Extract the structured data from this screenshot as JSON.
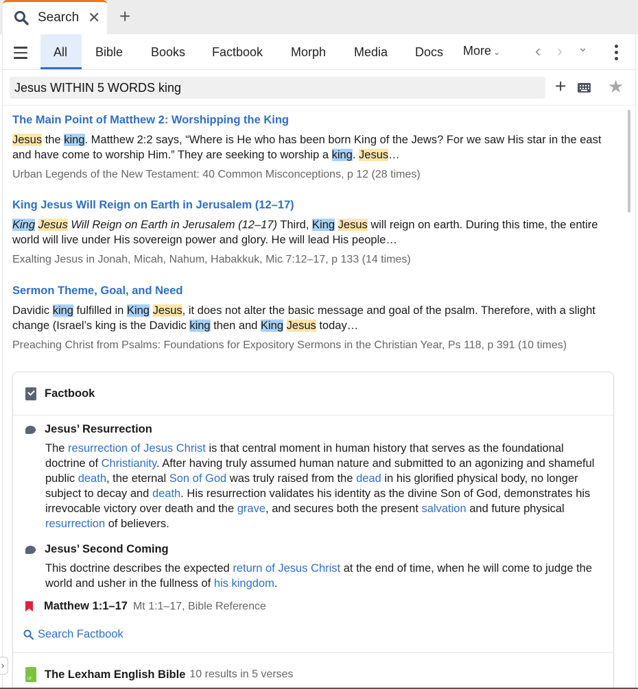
{
  "tab": {
    "title": "Search",
    "close": "✕",
    "new_tab": "+"
  },
  "categories": {
    "all": "All",
    "items": [
      "Bible",
      "Books",
      "Factbook",
      "Morph",
      "Media",
      "Docs"
    ],
    "more": "More",
    "more_chevron": "⌄"
  },
  "nav": {
    "back": "‹",
    "forward": "›",
    "dropdown": "⌄"
  },
  "search": {
    "query": "Jesus WITHIN 5 WORDS king",
    "add": "+",
    "star": "★"
  },
  "results": [
    {
      "title": "The Main Point of Matthew 2: Worshipping the King",
      "snippet": [
        {
          "t": "Jesus",
          "h": "j"
        },
        {
          "t": " the "
        },
        {
          "t": "king",
          "h": "k"
        },
        {
          "t": ". Matthew 2:2 says, “Where is He who has been born King of the Jews? For we saw His star in the east and have come to worship Him.” They are seeking to worship a "
        },
        {
          "t": "king",
          "h": "k"
        },
        {
          "t": ". "
        },
        {
          "t": "Jesus",
          "h": "j"
        },
        {
          "t": "…"
        }
      ],
      "source": "Urban Legends of the New Testament: 40 Common Misconceptions, p 12 (28 times)"
    },
    {
      "title": "King Jesus Will Reign on Earth in Jerusalem (12–17)",
      "snippet": [
        {
          "t": "King",
          "h": "k",
          "i": true
        },
        {
          "t": " ",
          "i": true
        },
        {
          "t": "Jesus",
          "h": "j",
          "i": true
        },
        {
          "t": " Will Reign on Earth in Jerusalem (12–17)",
          "i": true
        },
        {
          "t": " Third, "
        },
        {
          "t": "King",
          "h": "k"
        },
        {
          "t": " "
        },
        {
          "t": "Jesus",
          "h": "j"
        },
        {
          "t": " will reign on earth. During this time, the entire world will live under His sovereign power and glory. He will lead His people…"
        }
      ],
      "source": "Exalting Jesus in Jonah, Micah, Nahum, Habakkuk, Mic 7:12–17, p 133 (14 times)"
    },
    {
      "title": "Sermon Theme, Goal, and Need",
      "snippet": [
        {
          "t": "Davidic "
        },
        {
          "t": "king",
          "h": "k"
        },
        {
          "t": " fulfilled in "
        },
        {
          "t": "King",
          "h": "k"
        },
        {
          "t": " "
        },
        {
          "t": "Jesus",
          "h": "j"
        },
        {
          "t": ", it does not alter the basic message and goal of the psalm. Therefore, with a slight change (Israel’s king is the Davidic "
        },
        {
          "t": "king",
          "h": "k"
        },
        {
          "t": " then and "
        },
        {
          "t": "King",
          "h": "k"
        },
        {
          "t": " "
        },
        {
          "t": "Jesus",
          "h": "j"
        },
        {
          "t": " today…"
        }
      ],
      "source": "Preaching Christ from Psalms: Foundations for Expository Sermons in the Christian Year, Ps 118, p 391 (10 times)"
    }
  ],
  "factbook": {
    "heading": "Factbook",
    "entries": [
      {
        "title": "Jesus’ Resurrection",
        "body": [
          {
            "t": "The "
          },
          {
            "t": "resurrection of Jesus Christ",
            "l": true
          },
          {
            "t": " is that central moment in human history that serves as the foundational doctrine of "
          },
          {
            "t": "Christianity",
            "l": true
          },
          {
            "t": ". After having truly assumed human nature and submitted to an agonizing and shameful public "
          },
          {
            "t": "death",
            "l": true
          },
          {
            "t": ", the eternal "
          },
          {
            "t": "Son of God",
            "l": true
          },
          {
            "t": " was truly raised from the "
          },
          {
            "t": "dead",
            "l": true
          },
          {
            "t": " in his glorified physical body, no longer subject to decay and "
          },
          {
            "t": "death",
            "l": true
          },
          {
            "t": ". His resurrection validates his identity as the divine Son of God, demonstrates his irrevocable victory over death and the "
          },
          {
            "t": "grave",
            "l": true
          },
          {
            "t": ", and secures both the present "
          },
          {
            "t": "salvation",
            "l": true
          },
          {
            "t": " and future physical "
          },
          {
            "t": "resurrection",
            "l": true
          },
          {
            "t": " of believers."
          }
        ]
      },
      {
        "title": "Jesus’ Second Coming",
        "body": [
          {
            "t": "This doctrine describes the expected "
          },
          {
            "t": "return of Jesus Christ",
            "l": true
          },
          {
            "t": " at the end of time, when he will come to judge the world and usher in the fullness of "
          },
          {
            "t": "his kingdom",
            "l": true
          },
          {
            "t": "."
          }
        ]
      }
    ],
    "reference": {
      "title": "Matthew 1:1–17",
      "subtitle": "Mt 1:1–17, Bible Reference"
    },
    "search_link": "Search Factbook",
    "bible": {
      "title": "The Lexham English Bible",
      "subtitle": "10 results in 5 verses"
    }
  },
  "side_expand": "›"
}
